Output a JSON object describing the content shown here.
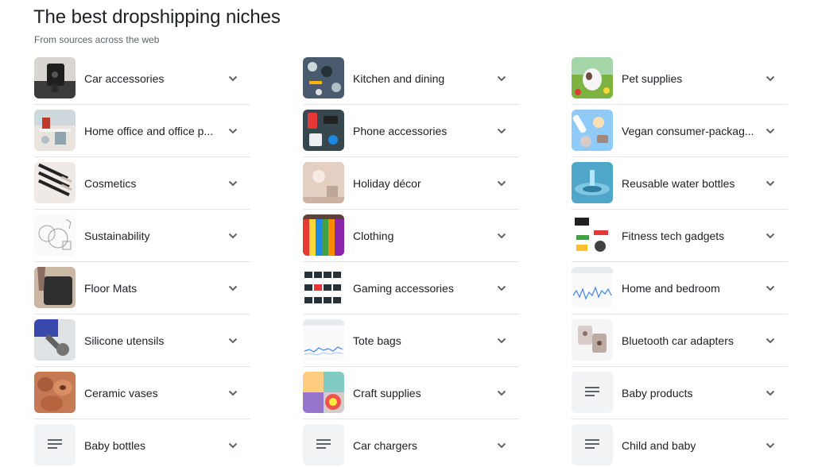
{
  "header": {
    "title": "The best dropshipping niches",
    "subtitle": "From sources across the web"
  },
  "columns": [
    {
      "items": [
        {
          "label": "Car accessories",
          "image": "car-phone-mount"
        },
        {
          "label": "Home office and office p...",
          "image": "home-office"
        },
        {
          "label": "Cosmetics",
          "image": "makeup-brushes"
        },
        {
          "label": "Sustainability",
          "image": "sketch-diagram"
        },
        {
          "label": "Floor Mats",
          "image": "floor-mat"
        },
        {
          "label": "Silicone utensils",
          "image": "silicone-utensil"
        },
        {
          "label": "Ceramic vases",
          "image": "ceramic-vases"
        },
        {
          "label": "Baby bottles",
          "image": "placeholder-doc-icon"
        }
      ]
    },
    {
      "items": [
        {
          "label": "Kitchen and dining",
          "image": "kitchen-tools"
        },
        {
          "label": "Phone accessories",
          "image": "phone-accessories"
        },
        {
          "label": "Holiday décor",
          "image": "holiday-room"
        },
        {
          "label": "Clothing",
          "image": "clothing-rack"
        },
        {
          "label": "Gaming accessories",
          "image": "gaming-products"
        },
        {
          "label": "Tote bags",
          "image": "trend-chart"
        },
        {
          "label": "Craft supplies",
          "image": "craft-supplies"
        },
        {
          "label": "Car chargers",
          "image": "placeholder-doc-icon"
        }
      ]
    },
    {
      "items": [
        {
          "label": "Pet supplies",
          "image": "dog-on-grass"
        },
        {
          "label": "Vegan consumer-packag...",
          "image": "vegan-products"
        },
        {
          "label": "Reusable water bottles",
          "image": "water-splash"
        },
        {
          "label": "Fitness tech gadgets",
          "image": "fitness-gadgets"
        },
        {
          "label": "Home and bedroom",
          "image": "trend-chart"
        },
        {
          "label": "Bluetooth car adapters",
          "image": "bluetooth-adapters"
        },
        {
          "label": "Baby products",
          "image": "placeholder-doc-icon"
        },
        {
          "label": "Child and baby",
          "image": "placeholder-doc-icon"
        }
      ]
    }
  ],
  "colors": {
    "text": "#202124",
    "muted": "#5f6368",
    "divider": "#e3e3e3",
    "placeholder_bg": "#f1f3f4"
  }
}
